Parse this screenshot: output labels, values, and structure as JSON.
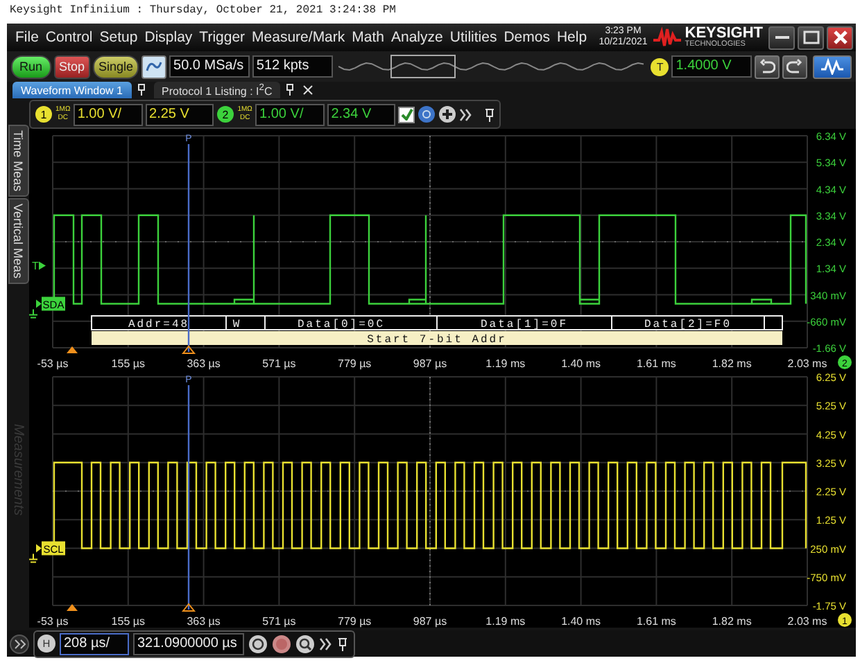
{
  "caption": "Keysight Infiniium : Thursday, October 21, 2021 3:24:38 PM",
  "menu": [
    "File",
    "Control",
    "Setup",
    "Display",
    "Trigger",
    "Measure/Mark",
    "Math",
    "Analyze",
    "Utilities",
    "Demos",
    "Help"
  ],
  "clock": {
    "time": "3:23 PM",
    "date": "10/21/2021"
  },
  "logo": {
    "name": "KEYSIGHT",
    "tagline": "TECHNOLOGIES"
  },
  "acquisition": {
    "buttons": [
      {
        "label": "Run",
        "kind": "run"
      },
      {
        "label": "Stop",
        "kind": "stop"
      },
      {
        "label": "Single",
        "kind": "single"
      }
    ],
    "sample_rate": "50.0 MSa/s",
    "memory_depth": "512 kpts"
  },
  "trigger": {
    "badge": "T",
    "level": "1.4000 V"
  },
  "tabs": [
    {
      "label": "Waveform Window 1",
      "selected": true
    },
    {
      "label": "Protocol 1 Listing : I$^{2}$C",
      "selected": false
    }
  ],
  "side_tabs": [
    "Time Meas",
    "Vertical Meas"
  ],
  "side_panel": "Measurements",
  "channels": [
    {
      "badge": "1",
      "impedance": "1MΩ",
      "coupling": "DC",
      "scale": "1.00 V/",
      "offset": "2.25 V",
      "color": "#e8e030"
    },
    {
      "badge": "2",
      "impedance": "1MΩ",
      "coupling": "DC",
      "scale": "1.00 V/",
      "offset": "2.34 V",
      "color": "#3cd23c"
    }
  ],
  "channel_toolbar": {
    "checked": true
  },
  "plots": [
    {
      "kind": "data",
      "signal": "SDA",
      "color": "#3cd23c",
      "badge": "2",
      "trigger_marker": "T",
      "cursor": "P",
      "y_labels": [
        "6.34 V",
        "5.34 V",
        "4.34 V",
        "3.34 V",
        "2.34 V",
        "1.34 V",
        "340 mV",
        "-660 mV",
        "-1.66 V"
      ],
      "x_labels": [
        "-53 µs",
        "155 µs",
        "363 µs",
        "571 µs",
        "779 µs",
        "987 µs",
        "1.19 ms",
        "1.40 ms",
        "1.61 ms",
        "1.82 ms",
        "2.03 ms"
      ],
      "decode": {
        "packets": [
          "Addr=48",
          "W",
          "Data[0]=0C",
          "Data[1]=0F",
          "Data[2]=F0"
        ],
        "status": "Start 7-bit Addr"
      }
    },
    {
      "kind": "clock",
      "signal": "SCL",
      "color": "#e8e030",
      "badge": "1",
      "cursor": "P",
      "y_labels": [
        "6.25 V",
        "5.25 V",
        "4.25 V",
        "3.25 V",
        "2.25 V",
        "1.25 V",
        "250 mV",
        "-750 mV",
        "-1.75 V"
      ],
      "x_labels": [
        "-53 µs",
        "155 µs",
        "363 µs",
        "571 µs",
        "779 µs",
        "987 µs",
        "1.19 ms",
        "1.40 ms",
        "1.61 ms",
        "1.82 ms",
        "2.03 ms"
      ]
    }
  ],
  "horizontal": {
    "badge": "H",
    "scale": "208 µs/",
    "position": "321.0900000 µs"
  }
}
